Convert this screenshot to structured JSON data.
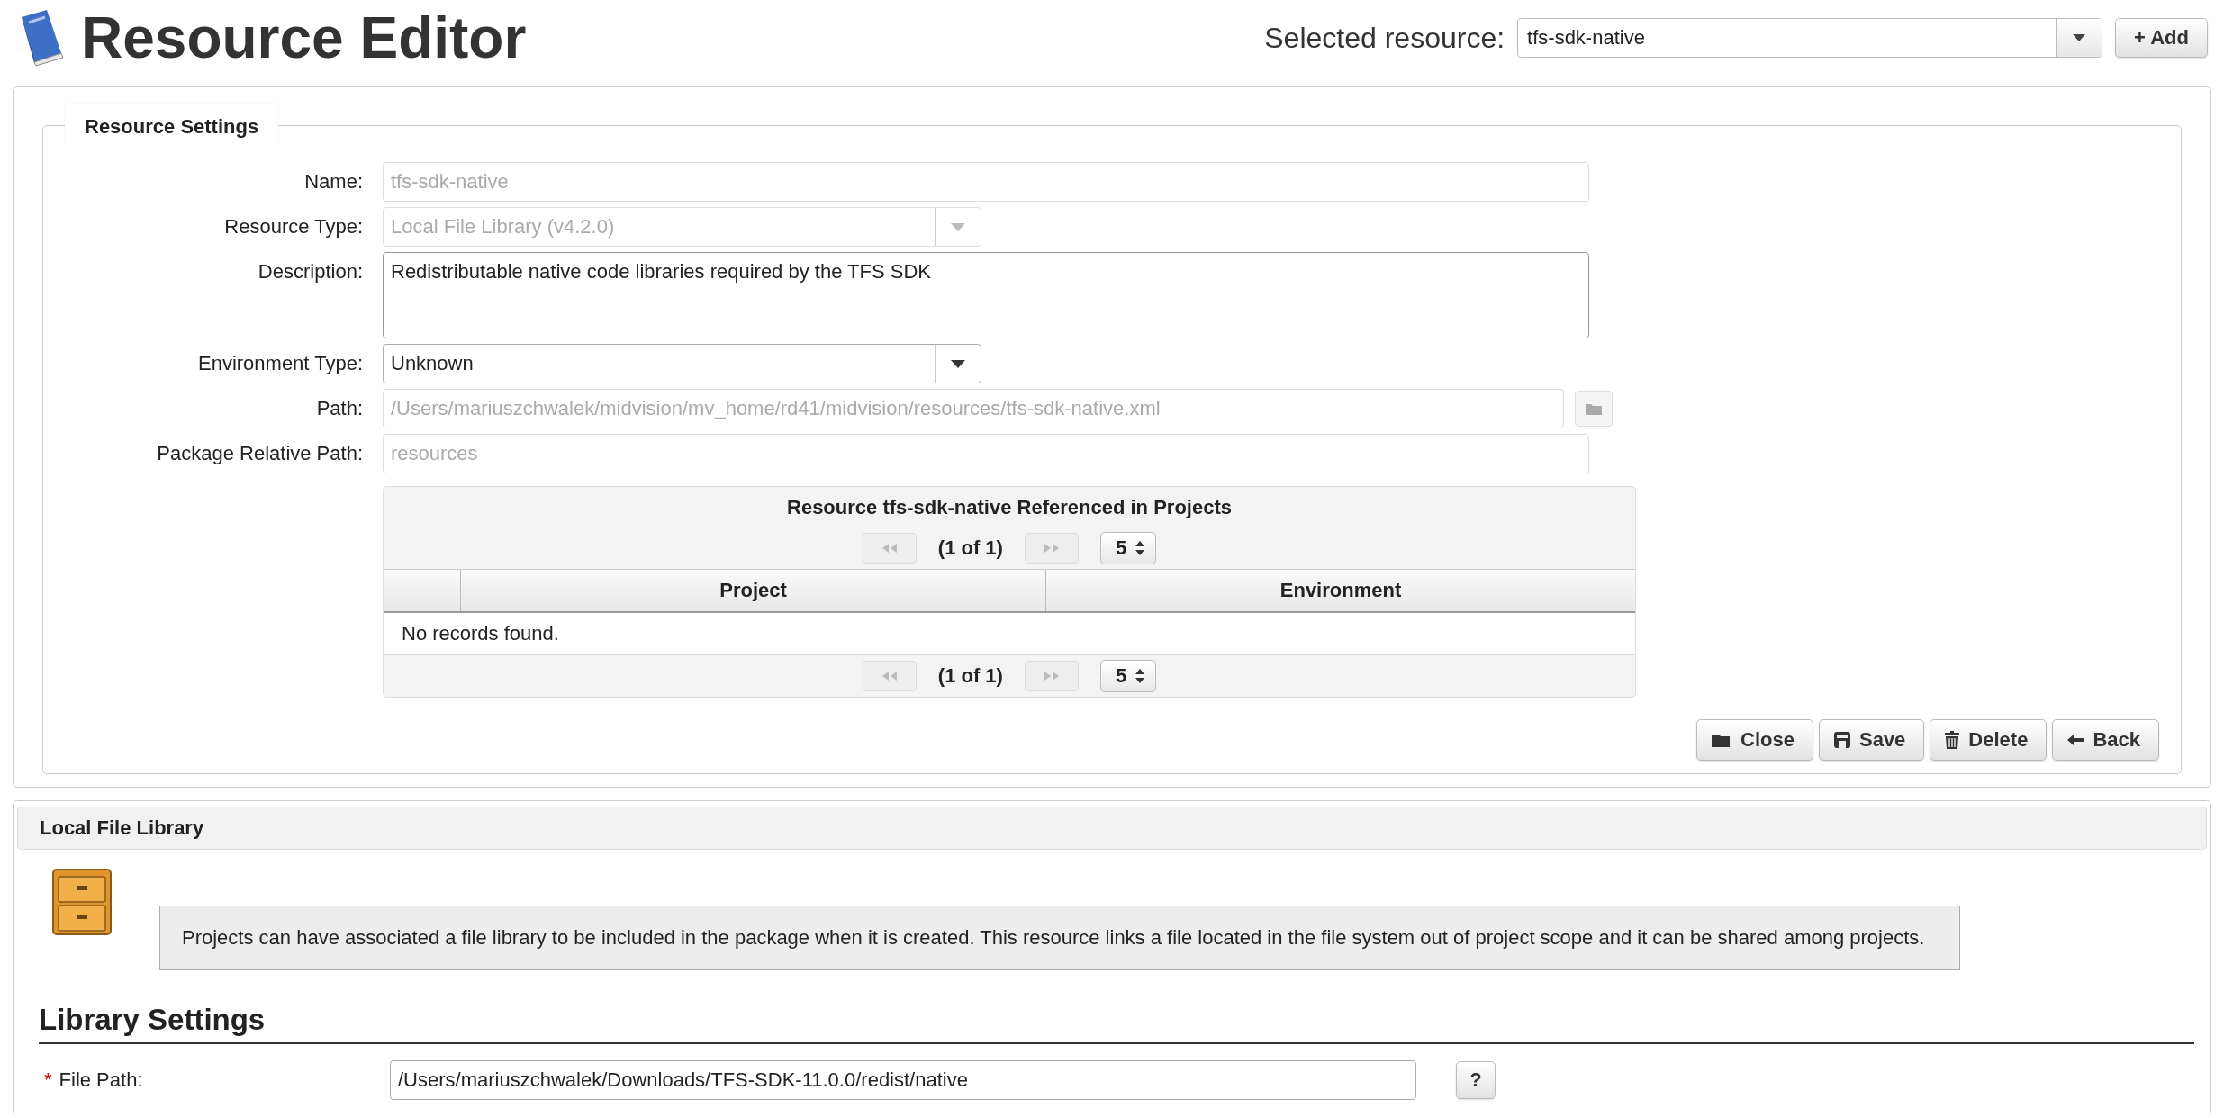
{
  "header": {
    "title": "Resource Editor",
    "selector_label": "Selected resource:",
    "selected_resource": "tfs-sdk-native",
    "add_button": "+ Add"
  },
  "resource_settings": {
    "legend": "Resource Settings",
    "fields": [
      {
        "kind": "text",
        "label": "Name:",
        "value": "tfs-sdk-native",
        "disabled": true
      },
      {
        "kind": "select",
        "label": "Resource Type:",
        "value": "Local File Library (v4.2.0)",
        "disabled": true
      },
      {
        "kind": "textarea",
        "label": "Description:",
        "value": "Redistributable native code libraries required by the TFS SDK",
        "disabled": false
      },
      {
        "kind": "select",
        "label": "Environment Type:",
        "value": "Unknown",
        "disabled": false
      },
      {
        "kind": "path",
        "label": "Path:",
        "value": "/Users/mariuszchwalek/midvision/mv_home/rd41/midvision/resources/tfs-sdk-native.xml",
        "disabled": true
      },
      {
        "kind": "text",
        "label": "Package Relative Path:",
        "value": "resources",
        "disabled": true
      }
    ],
    "table": {
      "title": "Resource tfs-sdk-native Referenced in Projects",
      "page_info": "(1 of 1)",
      "rows_per_page": "5",
      "columns": [
        "Project",
        "Environment"
      ],
      "empty_message": "No records found.",
      "bottom_page_info": "(1 of 1)",
      "bottom_rows_per_page": "5"
    },
    "buttons": [
      {
        "kind": "close",
        "label": "Close"
      },
      {
        "kind": "save",
        "label": "Save"
      },
      {
        "kind": "delete",
        "label": "Delete"
      },
      {
        "kind": "back",
        "label": "Back"
      }
    ]
  },
  "library": {
    "title": "Local File Library",
    "info": "Projects can have associated a file library to be included in the package when it is created. This resource links a file located in the file system out of project scope and it can be shared among projects.",
    "settings_title": "Library Settings",
    "required_mark": "*",
    "file_path_label": "File Path:",
    "file_path": "/Users/mariuszchwalek/Downloads/TFS-SDK-11.0.0/redist/native",
    "help_button": "?"
  }
}
